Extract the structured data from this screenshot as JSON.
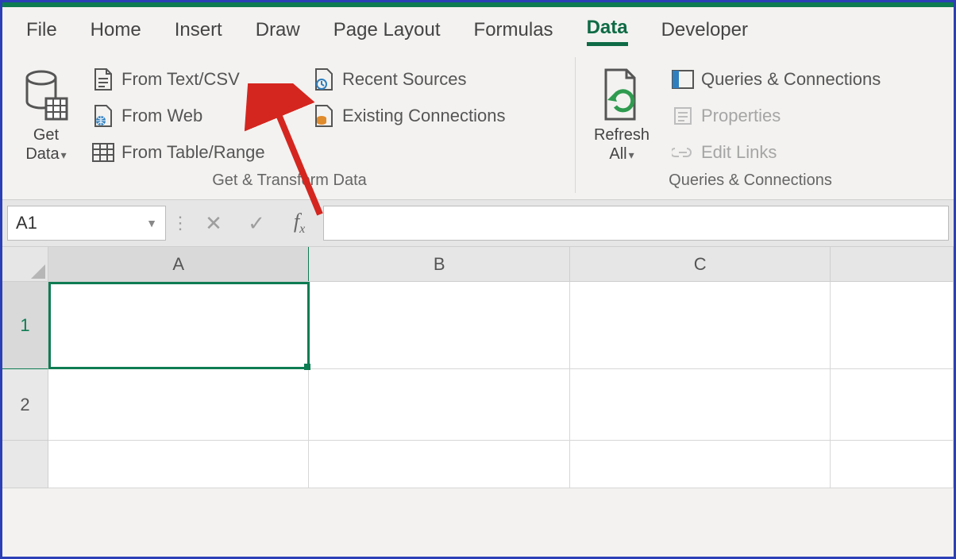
{
  "tabs": {
    "file": "File",
    "home": "Home",
    "insert": "Insert",
    "draw": "Draw",
    "page_layout": "Page Layout",
    "formulas": "Formulas",
    "data": "Data",
    "developer": "Developer",
    "active": "data"
  },
  "ribbon": {
    "get_transform": {
      "get_data": "Get\nData",
      "from_text_csv": "From Text/CSV",
      "from_web": "From Web",
      "from_table_range": "From Table/Range",
      "recent_sources": "Recent Sources",
      "existing_connections": "Existing Connections",
      "group_label": "Get & Transform Data"
    },
    "queries_conn": {
      "refresh_all": "Refresh\nAll",
      "queries_connections": "Queries & Connections",
      "properties": "Properties",
      "edit_links": "Edit Links",
      "group_label": "Queries & Connections"
    }
  },
  "formula_bar": {
    "selected_cell": "A1",
    "formula_value": ""
  },
  "columns": [
    "A",
    "B",
    "C"
  ],
  "rows": [
    "1",
    "2"
  ],
  "colors": {
    "accent": "#0e7c53",
    "border": "#2b3fb6",
    "arrow": "#d4261f"
  }
}
